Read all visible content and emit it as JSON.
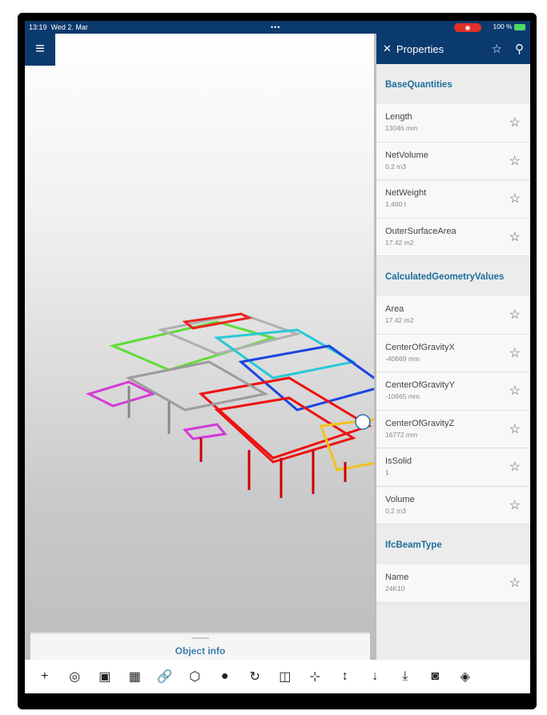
{
  "status": {
    "time": "13:19",
    "date": "Wed 2. Mar",
    "dots": "•••",
    "battery": "100 %"
  },
  "viewer": {
    "object_info": "Object info"
  },
  "properties": {
    "title": "Properties",
    "sections": [
      {
        "title": "BaseQuantities",
        "rows": [
          {
            "name": "Length",
            "value": "13046 mm"
          },
          {
            "name": "NetVolume",
            "value": "0.2 m3"
          },
          {
            "name": "NetWeight",
            "value": "1.460 t"
          },
          {
            "name": "OuterSurfaceArea",
            "value": "17.42 m2"
          }
        ]
      },
      {
        "title": "CalculatedGeometryValues",
        "rows": [
          {
            "name": "Area",
            "value": "17.42 m2"
          },
          {
            "name": "CenterOfGravityX",
            "value": "-40669 mm"
          },
          {
            "name": "CenterOfGravityY",
            "value": "-10665 mm"
          },
          {
            "name": "CenterOfGravityZ",
            "value": "16772 mm"
          },
          {
            "name": "IsSolid",
            "value": "1"
          },
          {
            "name": "Volume",
            "value": "0.2 m3"
          }
        ]
      },
      {
        "title": "IfcBeamType",
        "rows": [
          {
            "name": "Name",
            "value": "24K10"
          }
        ]
      }
    ]
  },
  "toolbar": [
    {
      "icon": "plus-icon",
      "glyph": "+"
    },
    {
      "icon": "hide-icon",
      "glyph": "◎"
    },
    {
      "icon": "view-icon",
      "glyph": "▣"
    },
    {
      "icon": "section-icon",
      "glyph": "▦"
    },
    {
      "icon": "link-icon",
      "glyph": "🔗"
    },
    {
      "icon": "cube-icon",
      "glyph": "⬡"
    },
    {
      "icon": "palette-icon",
      "glyph": "●"
    },
    {
      "icon": "rotate-icon",
      "glyph": "↻"
    },
    {
      "icon": "layers-icon",
      "glyph": "◫"
    },
    {
      "icon": "focus-icon",
      "glyph": "⊹"
    },
    {
      "icon": "measure-icon",
      "glyph": "↕"
    },
    {
      "icon": "measure-down-icon",
      "glyph": "↓"
    },
    {
      "icon": "measure-clock-icon",
      "glyph": "⤓"
    },
    {
      "icon": "camera-icon",
      "glyph": "◙"
    },
    {
      "icon": "model-icon",
      "glyph": "◈"
    }
  ]
}
